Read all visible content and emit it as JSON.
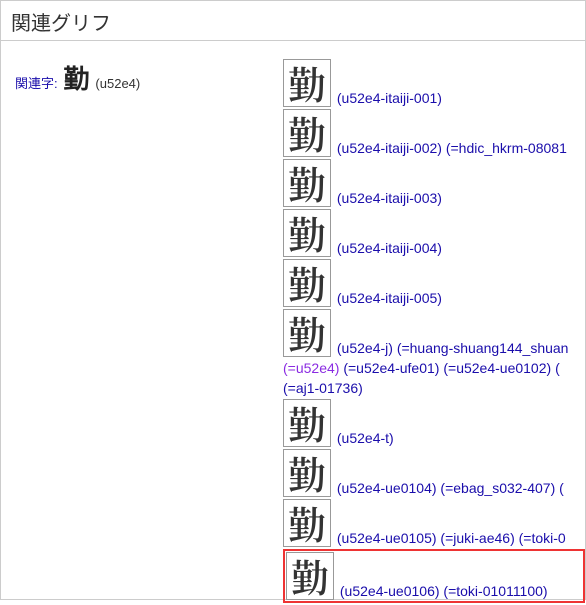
{
  "section_title": "関連グリフ",
  "left": {
    "label": "関連字:",
    "char": "勤",
    "code": "(u52e4)"
  },
  "glyphs": [
    {
      "char": "勤",
      "id": "(u52e4-itaiji-001)",
      "aliases": []
    },
    {
      "char": "勤",
      "id": "(u52e4-itaiji-002)",
      "aliases": [
        "(=hdic_hkrm-08081"
      ]
    },
    {
      "char": "勤",
      "id": "(u52e4-itaiji-003)",
      "aliases": []
    },
    {
      "char": "勤",
      "id": "(u52e4-itaiji-004)",
      "aliases": []
    },
    {
      "char": "勤",
      "id": "(u52e4-itaiji-005)",
      "aliases": []
    },
    {
      "char": "勤",
      "id": "(u52e4-j)",
      "aliases": [
        "(=huang-shuang144_shuan"
      ]
    },
    {
      "char": "勤",
      "id": "(u52e4-t)",
      "aliases": []
    },
    {
      "char": "勤",
      "id": "(u52e4-ue0104)",
      "aliases": [
        "(=ebag_s032-407)",
        "("
      ]
    },
    {
      "char": "勤",
      "id": "(u52e4-ue0105)",
      "aliases": [
        "(=juki-ae46)",
        "(=toki-0"
      ]
    },
    {
      "char": "勤",
      "id": "(u52e4-ue0106)",
      "aliases": [
        "(=toki-01011100)"
      ]
    }
  ],
  "extra_aliases": {
    "visited": "(=u52e4)",
    "rest": [
      "(=u52e4-ufe01)",
      "(=u52e4-ue0102)",
      "("
    ],
    "line2": "(=aj1-01736)"
  }
}
